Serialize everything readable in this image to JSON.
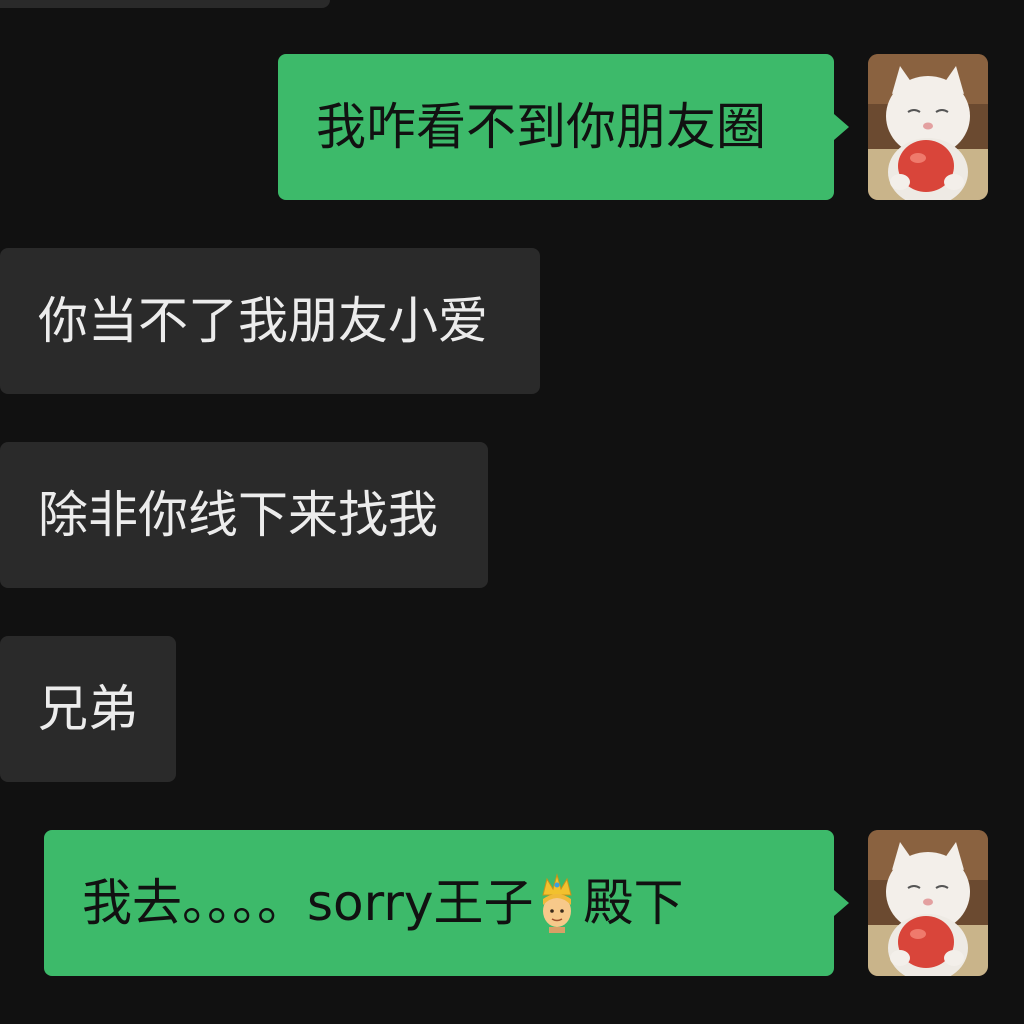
{
  "chat": {
    "messages": [
      {
        "side": "out",
        "text": "我咋看不到你朋友圈"
      },
      {
        "side": "in",
        "text": "你当不了我朋友小爱"
      },
      {
        "side": "in",
        "text": "除非你线下来找我"
      },
      {
        "side": "in",
        "text": "兄弟"
      },
      {
        "side": "out",
        "text_before": "我去。。。。sorry王子",
        "emoji": "prince-emoji",
        "text_after": "殿下"
      }
    ]
  },
  "avatar": {
    "icon": "cat-holding-apple-avatar"
  },
  "colors": {
    "background": "#111111",
    "outgoing_bubble": "#3dba6a",
    "incoming_bubble": "#2a2a2a",
    "incoming_text": "#ececec",
    "outgoing_text": "#111111"
  }
}
